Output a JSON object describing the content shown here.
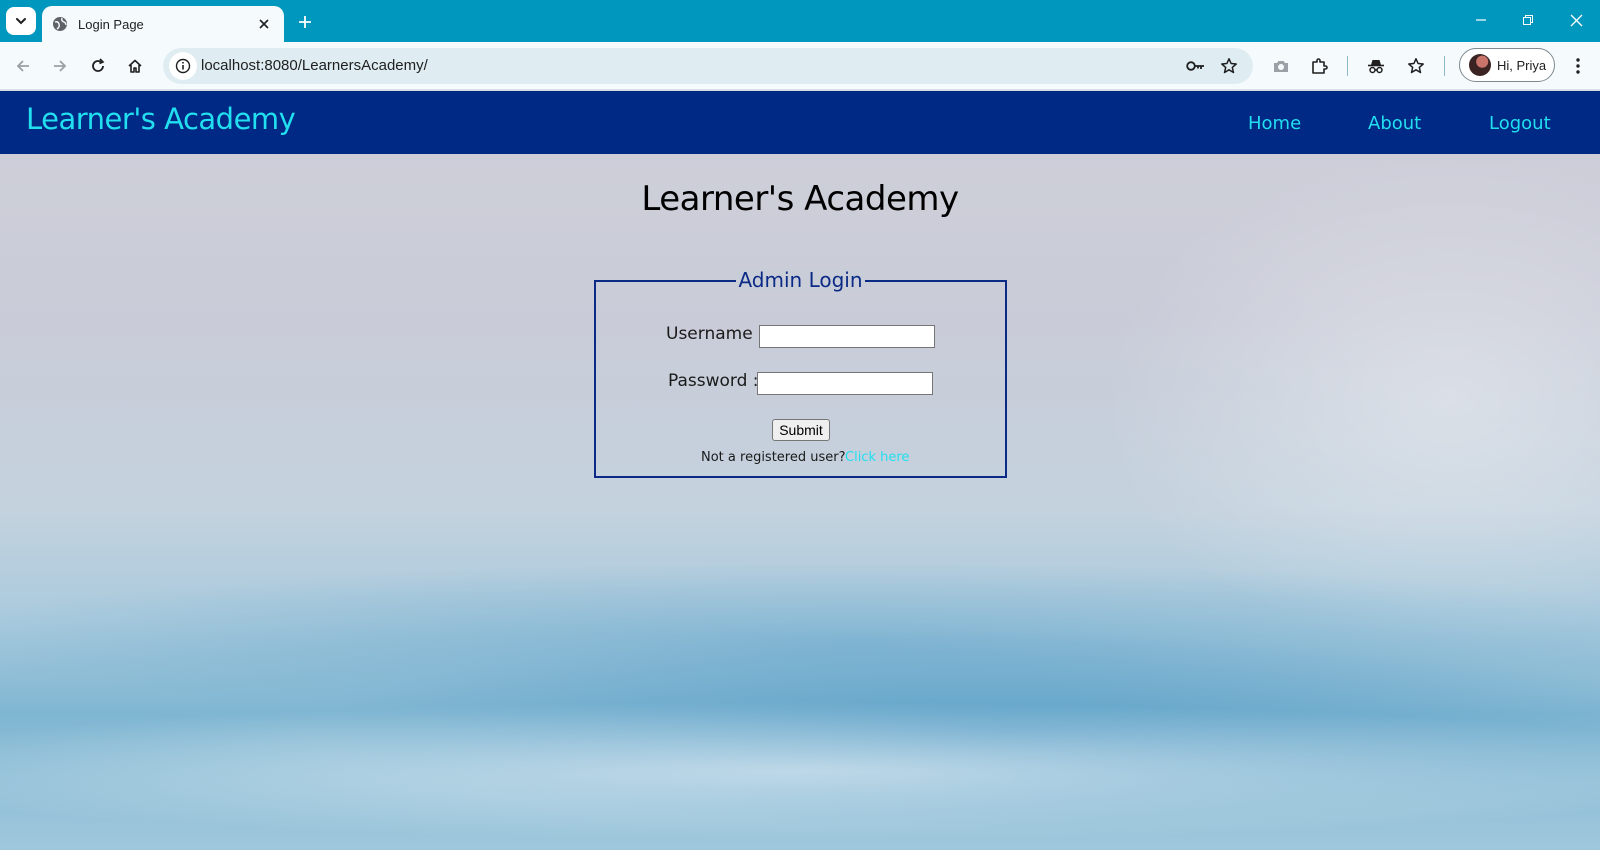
{
  "browser": {
    "tab": {
      "title": "Login Page",
      "favicon": "globe-icon"
    },
    "address_bar": {
      "url": "localhost:8080/LearnersAcademy/"
    },
    "profile": {
      "label": "Hi, Priya"
    },
    "accent_color": "#0097be"
  },
  "navbar": {
    "brand": "Learner's Academy",
    "links": [
      {
        "label": "Home"
      },
      {
        "label": "About"
      },
      {
        "label": "Logout"
      }
    ],
    "background_color": "#002885",
    "link_color": "#22dff0"
  },
  "main": {
    "heading": "Learner's Academy",
    "login_form": {
      "legend": "Admin Login",
      "username_label": "Username :",
      "username_value": "",
      "password_label": "Password :",
      "password_value": "",
      "submit_label": "Submit",
      "register_prompt": "Not a registered user?",
      "register_link": "Click here"
    }
  }
}
